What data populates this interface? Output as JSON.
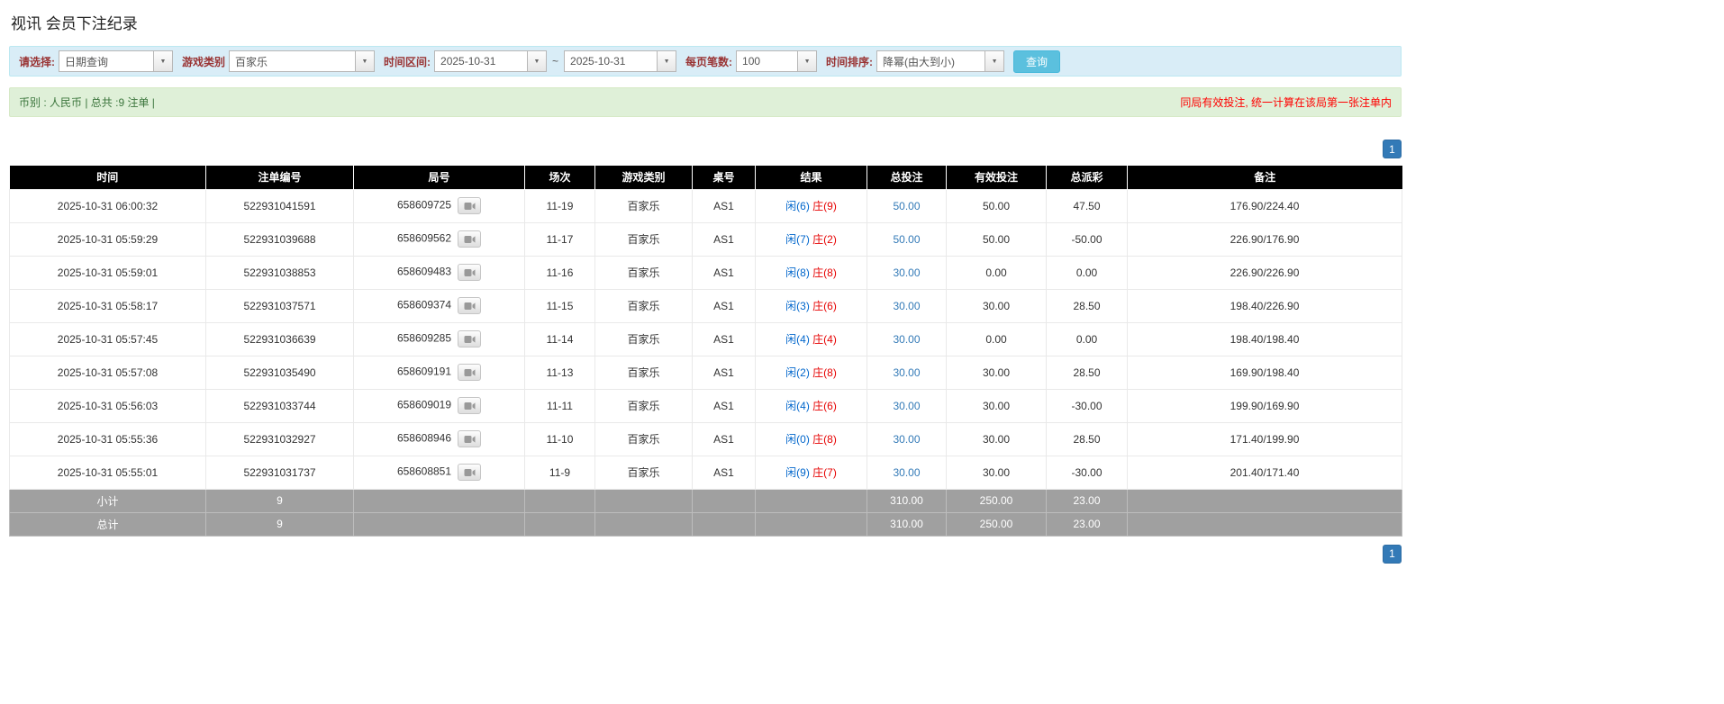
{
  "page": {
    "title": "视讯 会员下注纪录"
  },
  "filters": {
    "select_label": "请选择:",
    "select_value": "日期查询",
    "game_type_label": "游戏类别",
    "game_type_value": "百家乐",
    "date_range_label": "时间区间:",
    "date_from": "2025-10-31",
    "range_separator": "~",
    "date_to": "2025-10-31",
    "page_size_label": "每页笔数:",
    "page_size_value": "100",
    "sort_label": "时间排序:",
    "sort_value": "降幂(由大到小)",
    "search_button_label": "查询"
  },
  "info_bar": {
    "left_text": "币别 : 人民币 | 总共 :9 注单 |",
    "right_text": "同局有效投注, 统一计算在该局第一张注单内"
  },
  "pagination": {
    "page": "1"
  },
  "table": {
    "headers": [
      "时间",
      "注单编号",
      "局号",
      "场次",
      "游戏类别",
      "桌号",
      "结果",
      "总投注",
      "有效投注",
      "总派彩",
      "备注"
    ],
    "rows": [
      {
        "time": "2025-10-31 06:00:32",
        "bet_id": "522931041591",
        "round_id": "658609725",
        "session": "11-19",
        "game_type": "百家乐",
        "table_no": "AS1",
        "result_player": "闲(6)",
        "result_banker": "庄(9)",
        "total_bet": "50.00",
        "valid_bet": "50.00",
        "payout": "47.50",
        "remark": "176.90/224.40"
      },
      {
        "time": "2025-10-31 05:59:29",
        "bet_id": "522931039688",
        "round_id": "658609562",
        "session": "11-17",
        "game_type": "百家乐",
        "table_no": "AS1",
        "result_player": "闲(7)",
        "result_banker": "庄(2)",
        "total_bet": "50.00",
        "valid_bet": "50.00",
        "payout": "-50.00",
        "remark": "226.90/176.90"
      },
      {
        "time": "2025-10-31 05:59:01",
        "bet_id": "522931038853",
        "round_id": "658609483",
        "session": "11-16",
        "game_type": "百家乐",
        "table_no": "AS1",
        "result_player": "闲(8)",
        "result_banker": "庄(8)",
        "total_bet": "30.00",
        "valid_bet": "0.00",
        "payout": "0.00",
        "remark": "226.90/226.90"
      },
      {
        "time": "2025-10-31 05:58:17",
        "bet_id": "522931037571",
        "round_id": "658609374",
        "session": "11-15",
        "game_type": "百家乐",
        "table_no": "AS1",
        "result_player": "闲(3)",
        "result_banker": "庄(6)",
        "total_bet": "30.00",
        "valid_bet": "30.00",
        "payout": "28.50",
        "remark": "198.40/226.90"
      },
      {
        "time": "2025-10-31 05:57:45",
        "bet_id": "522931036639",
        "round_id": "658609285",
        "session": "11-14",
        "game_type": "百家乐",
        "table_no": "AS1",
        "result_player": "闲(4)",
        "result_banker": "庄(4)",
        "total_bet": "30.00",
        "valid_bet": "0.00",
        "payout": "0.00",
        "remark": "198.40/198.40"
      },
      {
        "time": "2025-10-31 05:57:08",
        "bet_id": "522931035490",
        "round_id": "658609191",
        "session": "11-13",
        "game_type": "百家乐",
        "table_no": "AS1",
        "result_player": "闲(2)",
        "result_banker": "庄(8)",
        "total_bet": "30.00",
        "valid_bet": "30.00",
        "payout": "28.50",
        "remark": "169.90/198.40"
      },
      {
        "time": "2025-10-31 05:56:03",
        "bet_id": "522931033744",
        "round_id": "658609019",
        "session": "11-11",
        "game_type": "百家乐",
        "table_no": "AS1",
        "result_player": "闲(4)",
        "result_banker": "庄(6)",
        "total_bet": "30.00",
        "valid_bet": "30.00",
        "payout": "-30.00",
        "remark": "199.90/169.90"
      },
      {
        "time": "2025-10-31 05:55:36",
        "bet_id": "522931032927",
        "round_id": "658608946",
        "session": "11-10",
        "game_type": "百家乐",
        "table_no": "AS1",
        "result_player": "闲(0)",
        "result_banker": "庄(8)",
        "total_bet": "30.00",
        "valid_bet": "30.00",
        "payout": "28.50",
        "remark": "171.40/199.90"
      },
      {
        "time": "2025-10-31 05:55:01",
        "bet_id": "522931031737",
        "round_id": "658608851",
        "session": "11-9",
        "game_type": "百家乐",
        "table_no": "AS1",
        "result_player": "闲(9)",
        "result_banker": "庄(7)",
        "total_bet": "30.00",
        "valid_bet": "30.00",
        "payout": "-30.00",
        "remark": "201.40/171.40"
      }
    ],
    "footer_rows": [
      {
        "label": "小计",
        "count": "9",
        "total_bet": "310.00",
        "valid_bet": "250.00",
        "payout": "23.00"
      },
      {
        "label": "总计",
        "count": "9",
        "total_bet": "310.00",
        "valid_bet": "250.00",
        "payout": "23.00"
      }
    ]
  },
  "colors": {
    "accent_blue": "#337ab7",
    "result_player_blue": "#0066cc",
    "result_banker_red": "#e60000",
    "negative_red": "#e60000",
    "header_bg": "#000000",
    "footer_bg": "#a0a0a0",
    "filter_bar_bg": "#d9edf7",
    "info_bar_bg": "#dff0d8",
    "search_button_bg": "#5bc0de",
    "filter_label_red": "#993333"
  }
}
